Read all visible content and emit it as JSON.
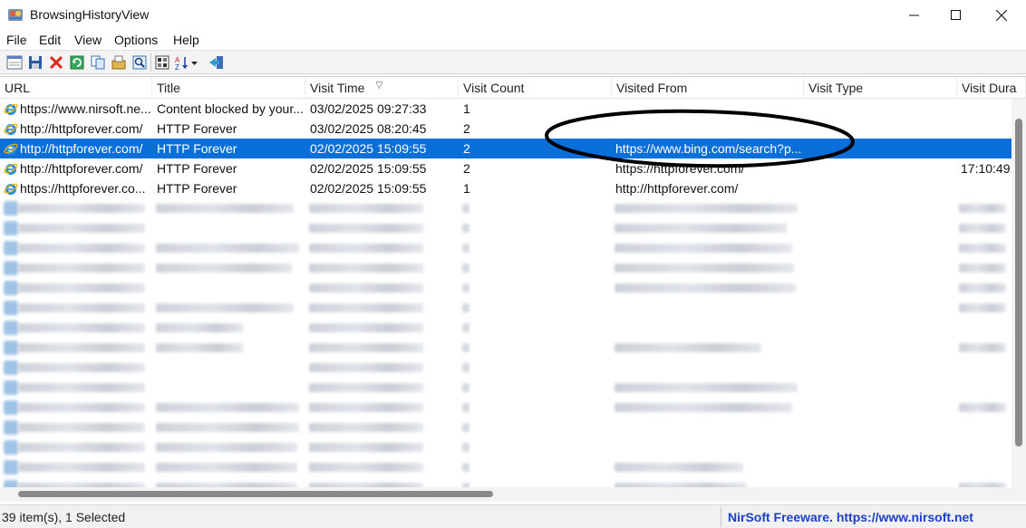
{
  "window": {
    "title": "BrowsingHistoryView",
    "minimize_glyph": "—",
    "maximize_glyph": "☐",
    "close_glyph": "✕"
  },
  "menu": [
    "File",
    "Edit",
    "View",
    "Options",
    "Help"
  ],
  "toolbar_icons": [
    "properties-icon",
    "save-icon",
    "delete-icon",
    "refresh-icon",
    "copy-icon",
    "open-options-icon",
    "find-icon",
    "html-report-icon",
    "sort-icon",
    "exit-icon"
  ],
  "columns": [
    "URL",
    "Title",
    "Visit Time",
    "Visit Count",
    "Visited From",
    "Visit Type",
    "Visit Dura"
  ],
  "sort_indicator": "▽",
  "rows": [
    {
      "url": "https://www.nirsoft.ne...",
      "title": "Content blocked by your...",
      "visit_time": "03/02/2025 09:27:33",
      "visit_count": "1",
      "visited_from": "",
      "visit_type": "",
      "visit_duration": ""
    },
    {
      "url": "http://httpforever.com/",
      "title": "HTTP Forever",
      "visit_time": "03/02/2025 08:20:45",
      "visit_count": "2",
      "visited_from": "",
      "visit_type": "",
      "visit_duration": ""
    },
    {
      "url": "http://httpforever.com/",
      "title": "HTTP Forever",
      "visit_time": "02/02/2025 15:09:55",
      "visit_count": "2",
      "visited_from": "https://www.bing.com/search?p...",
      "visit_type": "",
      "visit_duration": "",
      "selected": true
    },
    {
      "url": "http://httpforever.com/",
      "title": "HTTP Forever",
      "visit_time": "02/02/2025 15:09:55",
      "visit_count": "2",
      "visited_from": "https://httpforever.com/",
      "visit_type": "",
      "visit_duration": "17:10:49."
    },
    {
      "url": "https://httpforever.co...",
      "title": "HTTP Forever",
      "visit_time": "02/02/2025 15:09:55",
      "visit_count": "1",
      "visited_from": "http://httpforever.com/",
      "visit_type": "",
      "visit_duration": ""
    }
  ],
  "status": {
    "items": "39 item(s), 1 Selected",
    "credit": "NirSoft Freeware. https://www.nirsoft.net"
  },
  "colors": {
    "selection": "#0a6fd9",
    "credit_text": "#1d40c8",
    "annotation_ellipse": "#000000"
  }
}
